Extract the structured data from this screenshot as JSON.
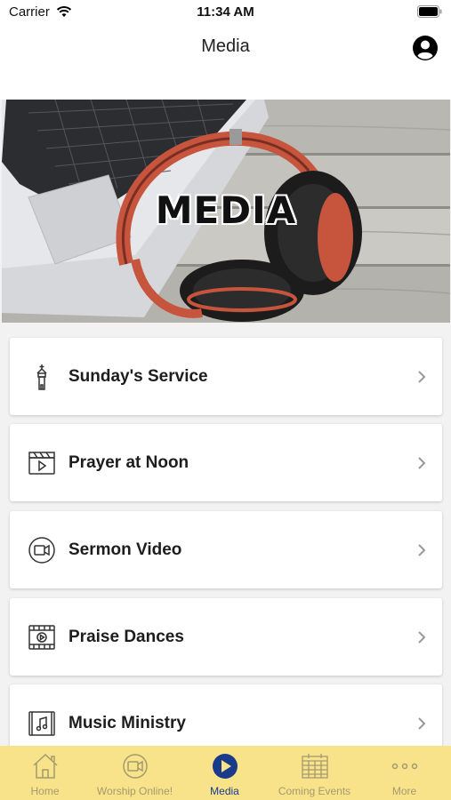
{
  "status": {
    "carrier": "Carrier",
    "time": "11:34 AM"
  },
  "nav": {
    "title": "Media"
  },
  "banner": {
    "text": "MEDIA"
  },
  "items": [
    {
      "label": "Sunday's Service",
      "icon": "church-icon"
    },
    {
      "label": "Prayer at Noon",
      "icon": "clapperboard-icon"
    },
    {
      "label": "Sermon Video",
      "icon": "video-camera-icon"
    },
    {
      "label": "Praise Dances",
      "icon": "film-play-icon"
    },
    {
      "label": "Music Ministry",
      "icon": "music-note-icon"
    }
  ],
  "tabs": [
    {
      "label": "Home",
      "icon": "home-icon",
      "active": false
    },
    {
      "label": "Worship Online!",
      "icon": "video-icon",
      "active": false
    },
    {
      "label": "Media",
      "icon": "play-icon",
      "active": true
    },
    {
      "label": "Coming Events",
      "icon": "calendar-icon",
      "active": false
    },
    {
      "label": "More",
      "icon": "more-dots-icon",
      "active": false
    }
  ],
  "colors": {
    "tabbar_bg": "#f9e38a",
    "tab_inactive": "#a39a6e",
    "tab_active": "#1a3a8a"
  }
}
